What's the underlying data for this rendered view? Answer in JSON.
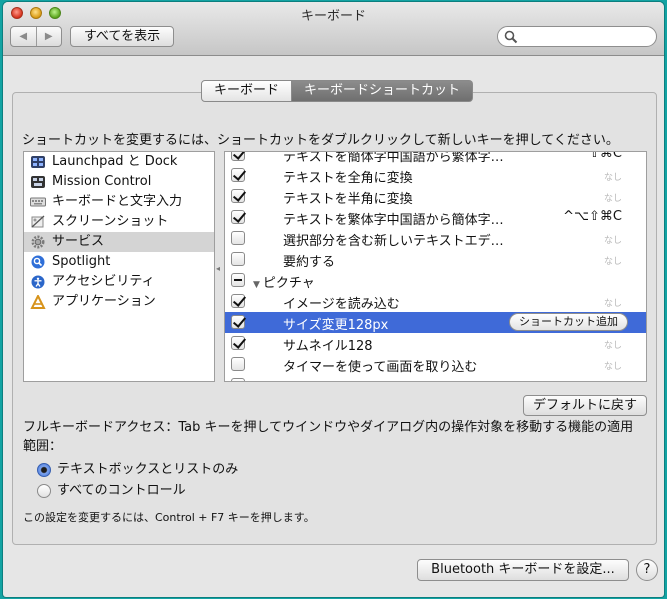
{
  "window": {
    "title": "キーボード"
  },
  "toolbar": {
    "back": "◀",
    "forward": "▶",
    "show_all": "すべてを表示",
    "search_value": ""
  },
  "tabs": [
    {
      "label": "キーボード",
      "active": false
    },
    {
      "label": "キーボードショートカット",
      "active": true
    }
  ],
  "instruction": "ショートカットを変更するには、ショートカットをダブルクリックして新しいキーを押してください。",
  "categories": [
    {
      "label": "Launchpad と Dock",
      "icon": "launchpad-icon",
      "selected": false
    },
    {
      "label": "Mission Control",
      "icon": "mission-control-icon",
      "selected": false
    },
    {
      "label": "キーボードと文字入力",
      "icon": "keyboard-icon",
      "selected": false
    },
    {
      "label": "スクリーンショット",
      "icon": "screenshot-icon",
      "selected": false
    },
    {
      "label": "サービス",
      "icon": "gear-icon",
      "selected": true
    },
    {
      "label": "Spotlight",
      "icon": "spotlight-icon",
      "selected": false
    },
    {
      "label": "アクセシビリティ",
      "icon": "accessibility-icon",
      "selected": false
    },
    {
      "label": "アプリケーション",
      "icon": "applications-icon",
      "selected": false
    }
  ],
  "shortcuts": [
    {
      "label": "テキストを簡体字中国語から繁体字…",
      "shortcut": "^⇧⌘C",
      "checked": "checked"
    },
    {
      "label": "テキストを全角に変換",
      "shortcut": "なし",
      "checked": "checked"
    },
    {
      "label": "テキストを半角に変換",
      "shortcut": "なし",
      "checked": "checked"
    },
    {
      "label": "テキストを繁体字中国語から簡体字…",
      "shortcut": "^⌥⇧⌘C",
      "checked": "checked"
    },
    {
      "label": "選択部分を含む新しいテキストエデ…",
      "shortcut": "なし",
      "checked": "unchecked"
    },
    {
      "label": "要約する",
      "shortcut": "なし",
      "checked": "unchecked"
    },
    {
      "label": "ピクチャ",
      "group": true,
      "checked": "mixed"
    },
    {
      "label": "イメージを読み込む",
      "shortcut": "なし",
      "checked": "checked"
    },
    {
      "label": "サイズ変更128px",
      "button": "ショートカット追加",
      "checked": "checked",
      "selected": true
    },
    {
      "label": "サムネイル128",
      "shortcut": "なし",
      "checked": "checked"
    },
    {
      "label": "タイマーを使って画面を取り込む",
      "shortcut": "なし",
      "checked": "unchecked"
    },
    {
      "label": "",
      "checked": "unchecked"
    }
  ],
  "defaults_button": "デフォルトに戻す",
  "full_keyboard_access": {
    "description": "フルキーボードアクセス：Tab キーを押してウインドウやダイアログ内の操作対象を移動する機能の適用範囲：",
    "options": [
      {
        "label": "テキストボックスとリストのみ",
        "selected": true
      },
      {
        "label": "すべてのコントロール",
        "selected": false
      }
    ],
    "note": "この設定を変更するには、Control + F7 キーを押します。"
  },
  "bluetooth_button": "Bluetooth キーボードを設定...",
  "help_label": "?",
  "colors": {
    "selection": "#3f6ad8",
    "desktop": "#13a3a3"
  }
}
